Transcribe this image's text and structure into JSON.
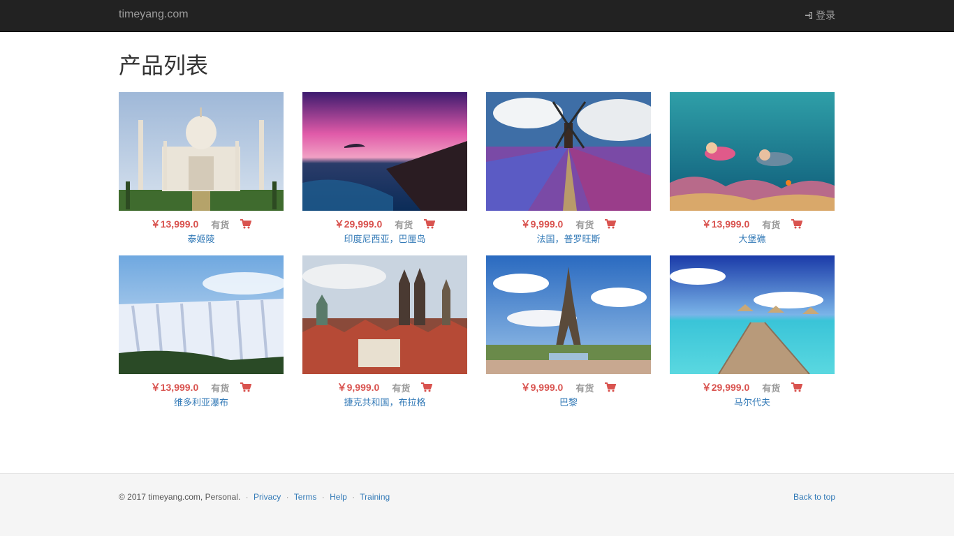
{
  "nav": {
    "brand": "timeyang.com",
    "login_label": "登录"
  },
  "page": {
    "title": "产品列表"
  },
  "products": [
    {
      "price": "￥13,999.0",
      "stock": "有货",
      "title": "泰姬陵",
      "scene": "taj"
    },
    {
      "price": "￥29,999.0",
      "stock": "有货",
      "title": "印度尼西亚，巴厘岛",
      "scene": "sunset"
    },
    {
      "price": "￥9,999.0",
      "stock": "有货",
      "title": "法国，普罗旺斯",
      "scene": "windmill"
    },
    {
      "price": "￥13,999.0",
      "stock": "有货",
      "title": "大堡礁",
      "scene": "reef"
    },
    {
      "price": "￥13,999.0",
      "stock": "有货",
      "title": "维多利亚瀑布",
      "scene": "falls"
    },
    {
      "price": "￥9,999.0",
      "stock": "有货",
      "title": "捷克共和国，布拉格",
      "scene": "prague"
    },
    {
      "price": "￥9,999.0",
      "stock": "有货",
      "title": "巴黎",
      "scene": "paris"
    },
    {
      "price": "￥29,999.0",
      "stock": "有货",
      "title": "马尔代夫",
      "scene": "maldives"
    }
  ],
  "footer": {
    "copyright": "© 2017 timeyang.com, Personal.",
    "links": [
      "Privacy",
      "Terms",
      "Help",
      "Training"
    ],
    "back_to_top": "Back to top"
  },
  "colors": {
    "navbar": "#222222",
    "price": "#d9534f",
    "link": "#337ab7",
    "stock": "#999999"
  }
}
